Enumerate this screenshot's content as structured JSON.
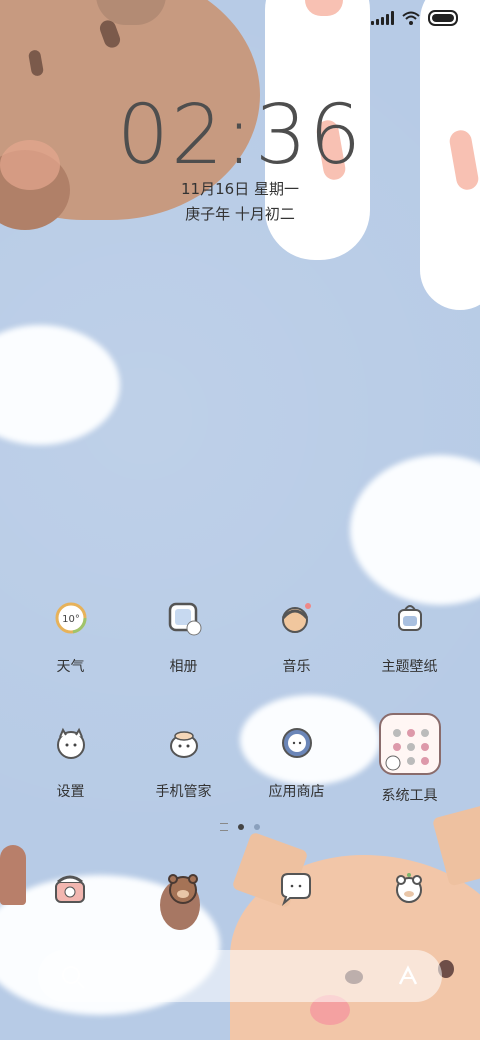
{
  "status_bar": {
    "icons": [
      "signal-icon",
      "wifi-icon",
      "battery-icon"
    ]
  },
  "lockscreen": {
    "time": "02:36",
    "date_line": "11月16日 星期一",
    "lunar_line": "庚子年 十月初二"
  },
  "apps": [
    {
      "label": "天气",
      "icon": "weather-icon"
    },
    {
      "label": "相册",
      "icon": "gallery-icon"
    },
    {
      "label": "音乐",
      "icon": "music-icon"
    },
    {
      "label": "主题壁纸",
      "icon": "themes-icon"
    },
    {
      "label": "设置",
      "icon": "settings-icon"
    },
    {
      "label": "手机管家",
      "icon": "security-icon"
    },
    {
      "label": "应用商店",
      "icon": "app-store-icon"
    },
    {
      "label": "系统工具",
      "icon": "tools-folder-icon"
    }
  ],
  "weather_icon_text": "10°",
  "dock": [
    {
      "icon": "phone-icon"
    },
    {
      "icon": "contacts-icon"
    },
    {
      "icon": "messages-icon"
    },
    {
      "icon": "browser-icon"
    }
  ],
  "page_indicator": {
    "pages": 2,
    "active": 1
  },
  "colors": {
    "wallpaper": "#b7cbe6",
    "text": "#333333",
    "clock": "#4e4e4e"
  }
}
